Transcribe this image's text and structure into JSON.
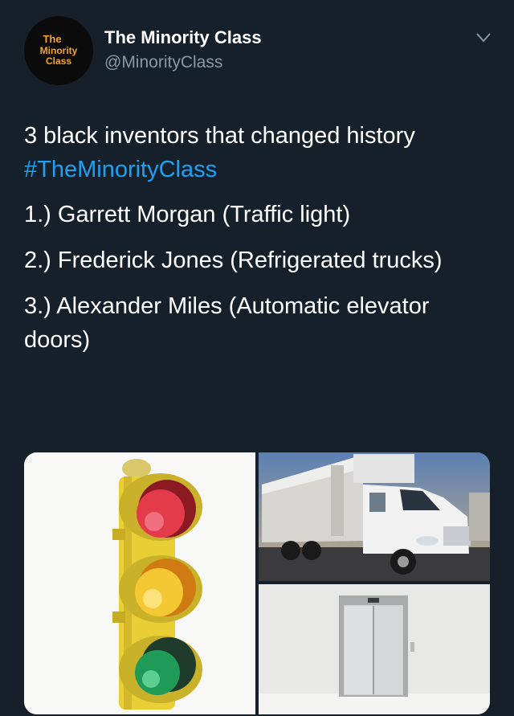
{
  "profile": {
    "avatar_lines": [
      "The",
      "Minority",
      "Class"
    ],
    "display_name": "The Minority Class",
    "handle": "@MinorityClass"
  },
  "tweet": {
    "headline": "3 black inventors that changed history",
    "hashtag": "#TheMinorityClass",
    "items": [
      "1.) Garrett Morgan (Traffic light)",
      "2.) Frederick Jones (Refrigerated trucks)",
      "3.) Alexander Miles (Automatic elevator doors)"
    ]
  },
  "colors": {
    "background": "#15202b",
    "text": "#ffffff",
    "secondary": "#8899a6",
    "link": "#1da1f2",
    "avatar_text": "#f5a623"
  },
  "icons": {
    "menu": "chevron-down-icon"
  }
}
